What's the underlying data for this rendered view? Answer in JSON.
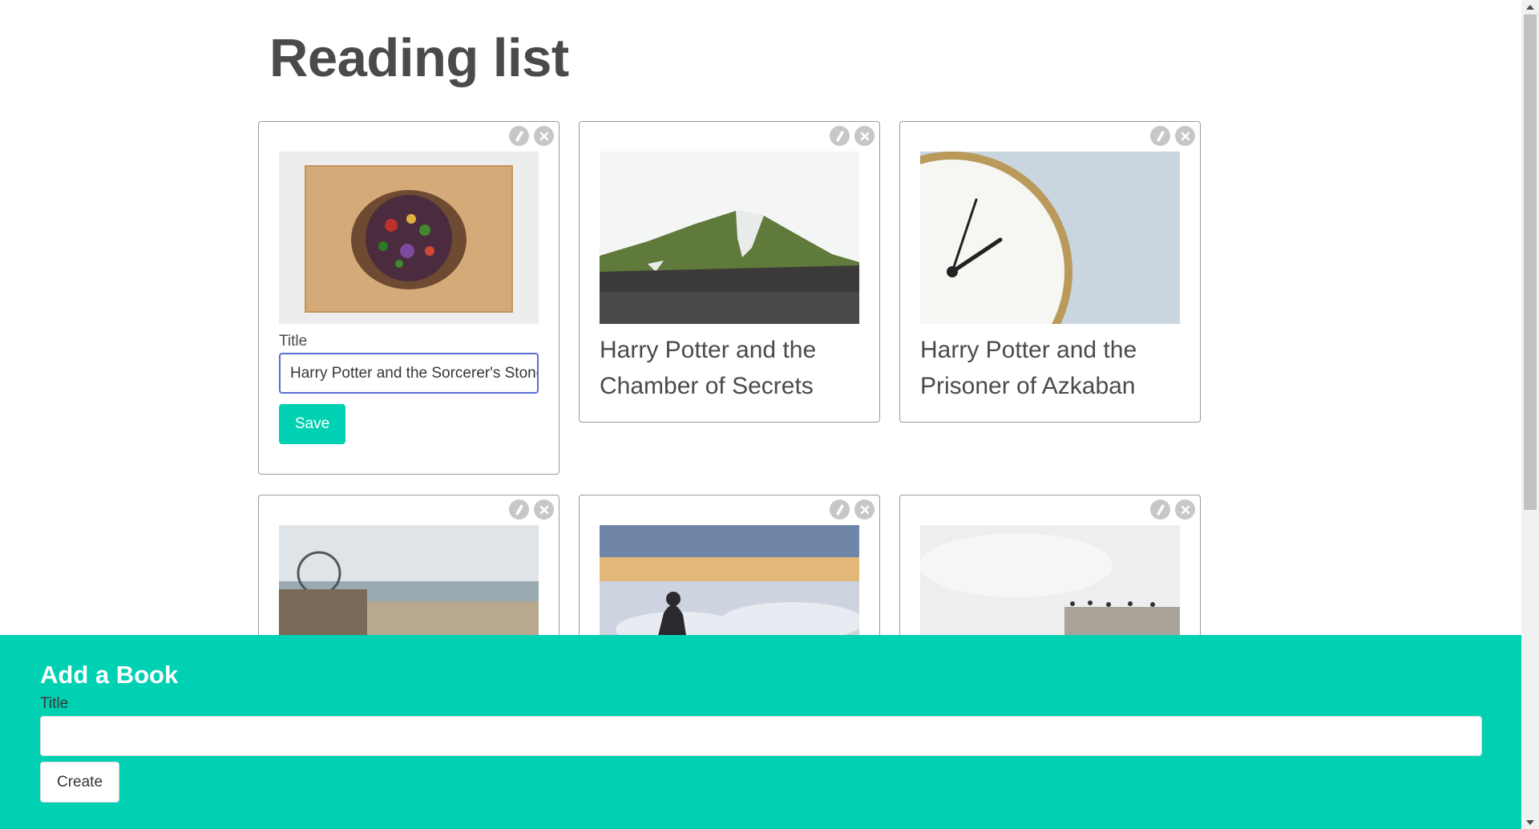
{
  "page": {
    "title": "Reading list"
  },
  "colors": {
    "accent": "#00d1b2",
    "focus": "#5b6bd4",
    "text": "#4a4a4a"
  },
  "card_actions": {
    "edit_icon": "pencil-icon",
    "delete_icon": "close-icon"
  },
  "books": [
    {
      "title": "Harry Potter and the Sorcerer's Stone",
      "image": "salad-bowl-on-cutting-board",
      "editing": true
    },
    {
      "title": "Harry Potter and the Chamber of Secrets",
      "image": "green-mountain-with-snow",
      "editing": false
    },
    {
      "title": "Harry Potter and the Prisoner of Azkaban",
      "image": "timex-alarm-clock",
      "editing": false
    },
    {
      "image": "seaside-pier-with-ferris-wheel"
    },
    {
      "image": "man-sitting-above-clouds"
    },
    {
      "image": "birds-on-wall-under-cloudy-sky"
    }
  ],
  "edit_form": {
    "label": "Title",
    "value": "Harry Potter and the Sorcerer's Stone",
    "save_label": "Save"
  },
  "add_form": {
    "heading": "Add a Book",
    "label": "Title",
    "value": "",
    "create_label": "Create"
  }
}
